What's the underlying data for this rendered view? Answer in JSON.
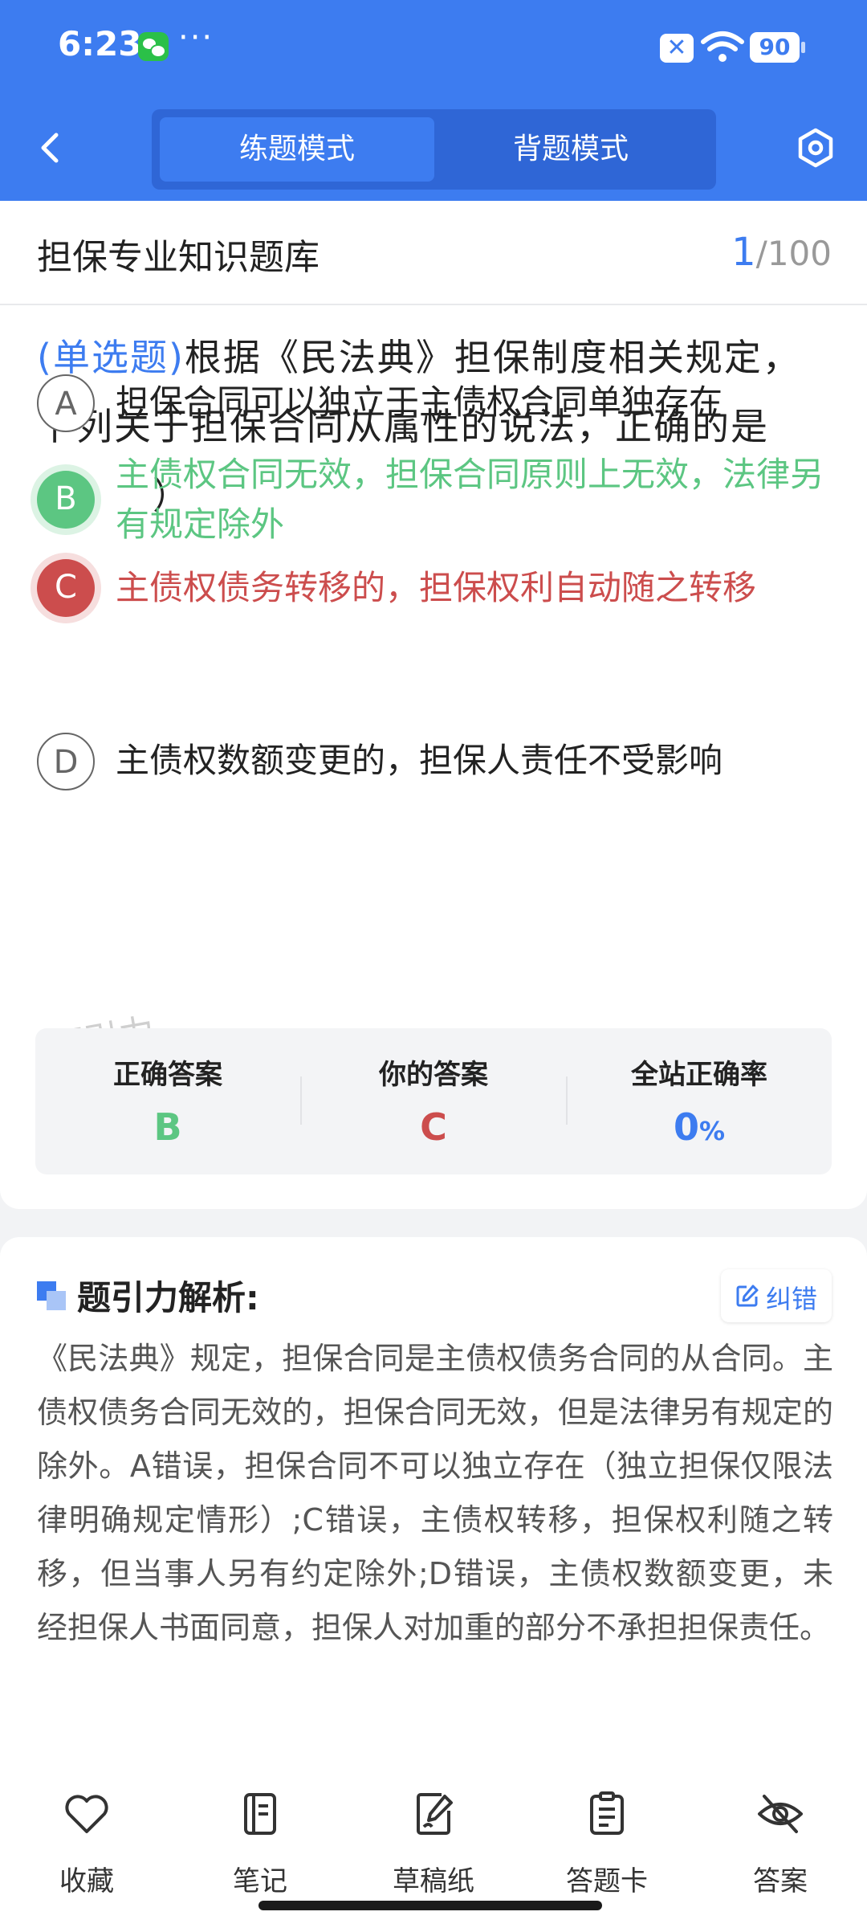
{
  "status_bar": {
    "time": "6:23",
    "more": "···",
    "battery": "90"
  },
  "header": {
    "modes": [
      "练题模式",
      "背题模式"
    ],
    "active_mode_index": 0
  },
  "title_row": {
    "bank_title": "担保专业知识题库",
    "current": "1",
    "total": "/100"
  },
  "question": {
    "type": "(单选题)",
    "text": "根据《民法典》担保制度相关规定，下列关于担保合同从属性的说法，正确的是（　　）",
    "options": [
      {
        "letter": "A",
        "text": "担保合同可以独立于主债权合同单独存在",
        "state": "plain"
      },
      {
        "letter": "B",
        "text": "主债权合同无效，担保合同原则上无效，法律另有规定除外",
        "state": "right"
      },
      {
        "letter": "C",
        "text": "主债权债务转移的，担保权利自动随之转移",
        "state": "wrong"
      },
      {
        "letter": "D",
        "text": "主债权数额变更的，担保人责任不受影响",
        "state": "plain"
      }
    ],
    "watermark": "题引力"
  },
  "stats": {
    "correct_label": "正确答案",
    "correct_value": "B",
    "yours_label": "你的答案",
    "yours_value": "C",
    "rate_label": "全站正确率",
    "rate_value": "0",
    "rate_unit": "%"
  },
  "analysis": {
    "title": "题引力解析:",
    "correct_button": "纠错",
    "text": "《民法典》规定，担保合同是主债权债务合同的从合同。主债权债务合同无效的，担保合同无效，但是法律另有规定的除外。A错误，担保合同不可以独立存在（独立担保仅限法律明确规定情形）;C错误，主债权转移，担保权利随之转移，但当事人另有约定除外;D错误，主债权数额变更，未经担保人书面同意，担保人对加重的部分不承担担保责任。"
  },
  "bottom_bar": {
    "items": [
      {
        "label": "收藏",
        "icon": "heart-icon"
      },
      {
        "label": "笔记",
        "icon": "notebook-icon"
      },
      {
        "label": "草稿纸",
        "icon": "draft-icon"
      },
      {
        "label": "答题卡",
        "icon": "clipboard-icon"
      },
      {
        "label": "答案",
        "icon": "eye-off-icon"
      }
    ]
  },
  "colors": {
    "brand": "#3d7cf0",
    "correct": "#5cc682",
    "wrong": "#cc4d4d"
  }
}
